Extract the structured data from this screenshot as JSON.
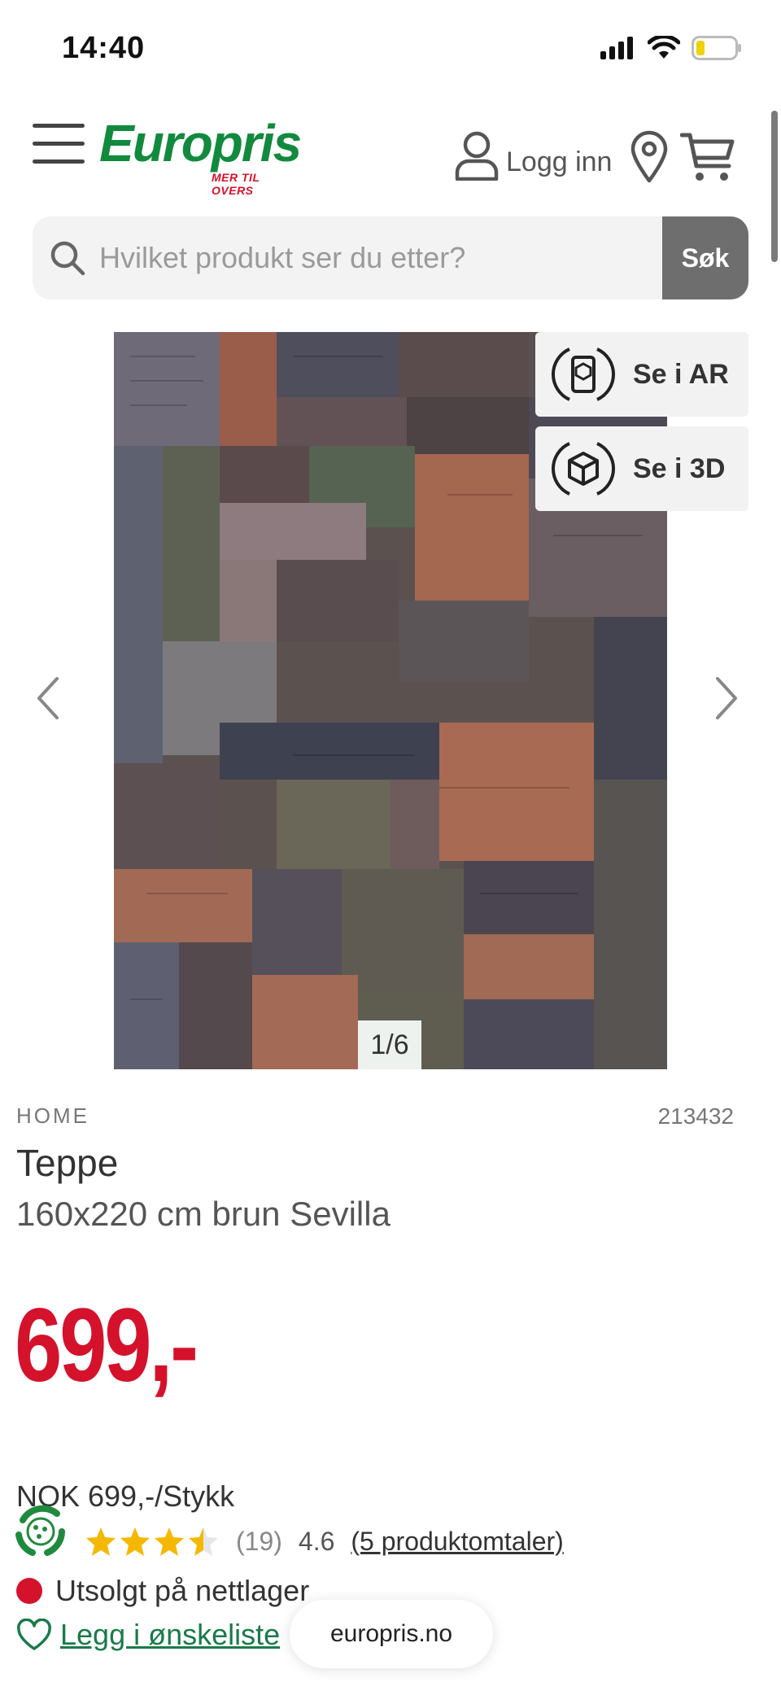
{
  "status_bar": {
    "time": "14:40"
  },
  "header": {
    "logo_text": "Europris",
    "logo_tagline": "MER TIL OVERS",
    "login_label": "Logg inn",
    "brand_green": "#128a3e",
    "brand_red": "#d5122b"
  },
  "search": {
    "placeholder": "Hvilket produkt ser du etter?",
    "button_label": "Søk"
  },
  "gallery": {
    "ar_label": "Se i AR",
    "three_d_label": "Se i 3D",
    "counter": "1/6"
  },
  "product": {
    "breadcrumb": "HOME",
    "sku": "213432",
    "title": "Teppe",
    "subtitle": "160x220 cm brun Sevilla",
    "price": "699,-",
    "unit_price": "NOK 699,-/Stykk",
    "rating_count": "(19)",
    "rating_value": "4.6",
    "reviews_link": "(5 produktomtaler)",
    "stars_filled": 3.5,
    "stars_total": 5,
    "stock_status": "Utsolgt på nettlager",
    "wishlist_label": "Legg i ønskeliste"
  },
  "browser": {
    "url": "europris.no"
  }
}
